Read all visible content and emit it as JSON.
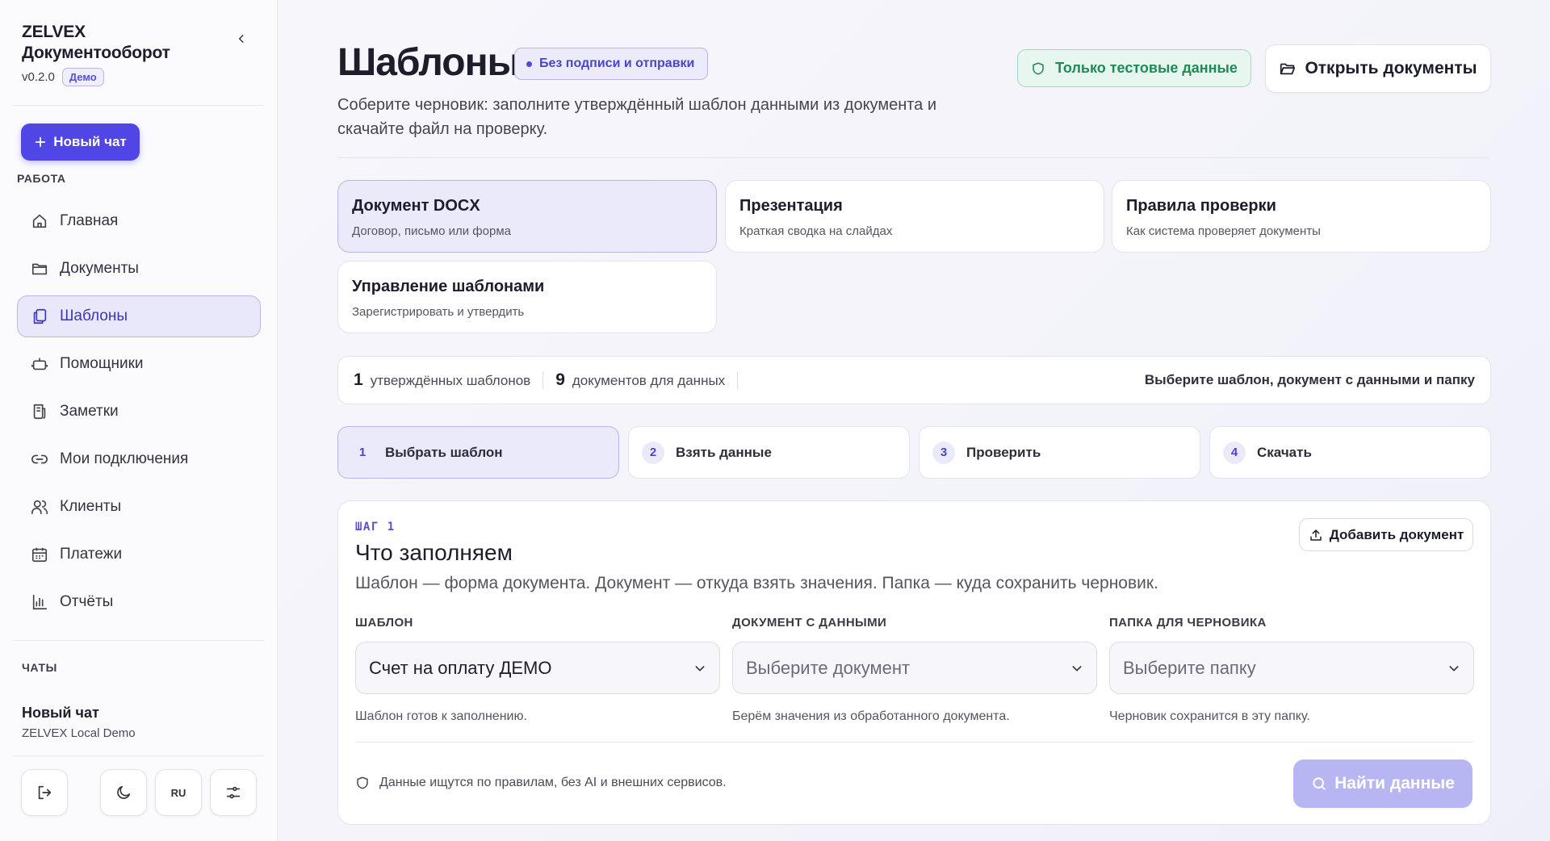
{
  "brand": {
    "name_line1": "ZELVEX",
    "name_line2": "Документооборот",
    "version": "v0.2.0",
    "badge": "Демо"
  },
  "sidebar": {
    "new_chat_label": "Новый чат",
    "section_work": "РАБОТА",
    "items": [
      {
        "label": "Главная",
        "icon": "home-icon"
      },
      {
        "label": "Документы",
        "icon": "folder-icon"
      },
      {
        "label": "Шаблоны",
        "icon": "templates-icon",
        "active": true
      },
      {
        "label": "Помощники",
        "icon": "robot-icon"
      },
      {
        "label": "Заметки",
        "icon": "notes-icon"
      },
      {
        "label": "Мои подключения",
        "icon": "link-icon"
      },
      {
        "label": "Клиенты",
        "icon": "users-icon"
      },
      {
        "label": "Платежи",
        "icon": "calendar-icon"
      },
      {
        "label": "Отчёты",
        "icon": "chart-icon"
      }
    ],
    "section_chats": "ЧАТЫ",
    "chat": {
      "title": "Новый чат",
      "subtitle": "ZELVEX Local Demo"
    },
    "lang_label": "RU"
  },
  "header": {
    "title": "Шаблоны",
    "badge": "Без подписи и отправки",
    "subtitle": "Соберите черновик: заполните утверждённый шаблон данными из документа и скачайте файл на проверку.",
    "test_data_label": "Только тестовые данные",
    "open_docs_label": "Открыть документы"
  },
  "type_cards": [
    {
      "title": "Документ DOCX",
      "subtitle": "Договор, письмо или форма",
      "active": true
    },
    {
      "title": "Презентация",
      "subtitle": "Краткая сводка на слайдах"
    },
    {
      "title": "Правила проверки",
      "subtitle": "Как система проверяет документы"
    },
    {
      "title": "Управление шаблонами",
      "subtitle": "Зарегистрировать и утвердить"
    }
  ],
  "stats": {
    "approved_count": "1",
    "approved_label": "утверждённых шаблонов",
    "docs_count": "9",
    "docs_label": "документов для данных",
    "hint": "Выберите шаблон, документ с данными и папку"
  },
  "steps": [
    {
      "num": "1",
      "label": "Выбрать шаблон",
      "active": true
    },
    {
      "num": "2",
      "label": "Взять данные"
    },
    {
      "num": "3",
      "label": "Проверить"
    },
    {
      "num": "4",
      "label": "Скачать"
    }
  ],
  "form": {
    "eyebrow": "ШАГ 1",
    "title": "Что заполняем",
    "description": "Шаблон — форма документа. Документ — откуда взять значения. Папка — куда сохранить черновик.",
    "add_doc_label": "Добавить документ",
    "fields": [
      {
        "label": "ШАБЛОН",
        "value": "Счет на оплату ДЕМО",
        "help": "Шаблон готов к заполнению."
      },
      {
        "label": "ДОКУМЕНТ С ДАННЫМИ",
        "placeholder": "Выберите документ",
        "help": "Берём значения из обработанного документа."
      },
      {
        "label": "ПАПКА ДЛЯ ЧЕРНОВИКА",
        "placeholder": "Выберите папку",
        "help": "Черновик сохранится в эту папку."
      }
    ],
    "note": "Данные ищутся по правилам, без AI и внешних сервисов.",
    "find_label": "Найти данные"
  },
  "colors": {
    "accent": "#4f46e5",
    "accent_soft": "#ebeafb",
    "success": "#1f8a57",
    "disabled": "#b8b5f3"
  }
}
